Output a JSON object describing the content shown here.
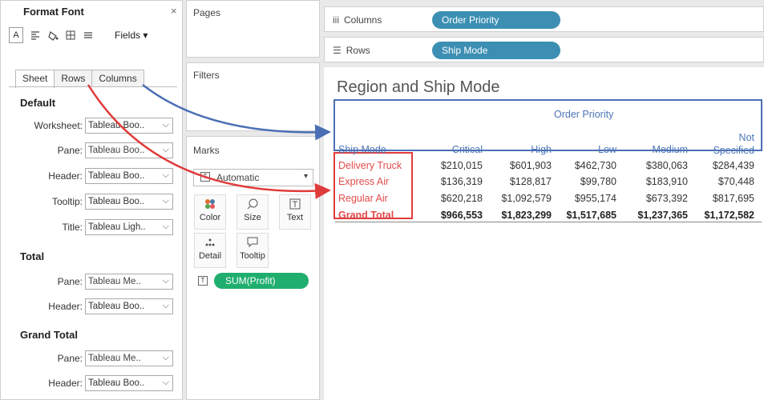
{
  "format_panel": {
    "title": "Format Font",
    "close": "×",
    "toolbar_a": "A",
    "fields_label": "Fields ▾",
    "tabs": [
      "Sheet",
      "Rows",
      "Columns"
    ],
    "sections": {
      "default": "Default",
      "total": "Total",
      "grand_total": "Grand Total"
    },
    "default_rows": [
      {
        "label": "Worksheet:",
        "value": "Tableau Boo.."
      },
      {
        "label": "Pane:",
        "value": "Tableau Boo.."
      },
      {
        "label": "Header:",
        "value": "Tableau Boo.."
      },
      {
        "label": "Tooltip:",
        "value": "Tableau Boo.."
      },
      {
        "label": "Title:",
        "value": "Tableau Ligh.."
      }
    ],
    "total_rows": [
      {
        "label": "Pane:",
        "value": "Tableau Me.."
      },
      {
        "label": "Header:",
        "value": "Tableau Boo.."
      }
    ],
    "grand_total_rows": [
      {
        "label": "Pane:",
        "value": "Tableau Me.."
      },
      {
        "label": "Header:",
        "value": "Tableau Boo.."
      }
    ]
  },
  "pages": {
    "title": "Pages"
  },
  "filters": {
    "title": "Filters"
  },
  "marks": {
    "title": "Marks",
    "type": "Automatic",
    "cards": [
      "Color",
      "Size",
      "Text",
      "Detail",
      "Tooltip"
    ],
    "pill": "SUM(Profit)",
    "pill_color": "#1fae6e"
  },
  "shelves": {
    "columns_label": "Columns",
    "columns_pill": "Order Priority",
    "rows_label": "Rows",
    "rows_pill": "Ship Mode",
    "pill_color": "#3c8fb3"
  },
  "viz": {
    "title": "Region and Ship Mode",
    "col_group_header": "Order Priority",
    "row_header": "Ship Mode",
    "columns": [
      "Critical",
      "High",
      "Low",
      "Medium",
      "Not Specified"
    ],
    "rows": [
      {
        "label": "Delivery Truck",
        "values": [
          "$210,015",
          "$601,903",
          "$462,730",
          "$380,063",
          "$284,439"
        ]
      },
      {
        "label": "Express Air",
        "values": [
          "$136,319",
          "$128,817",
          "$99,780",
          "$183,910",
          "$70,448"
        ]
      },
      {
        "label": "Regular Air",
        "values": [
          "$620,218",
          "$1,092,579",
          "$955,174",
          "$673,392",
          "$817,695"
        ]
      },
      {
        "label": "Grand Total",
        "values": [
          "$966,553",
          "$1,823,299",
          "$1,517,685",
          "$1,237,365",
          "$1,172,582"
        ]
      }
    ],
    "header_color": "#4d75b7",
    "highlight_colors": {
      "blue": "#4a6fb5",
      "red": "#e03b3b"
    }
  }
}
